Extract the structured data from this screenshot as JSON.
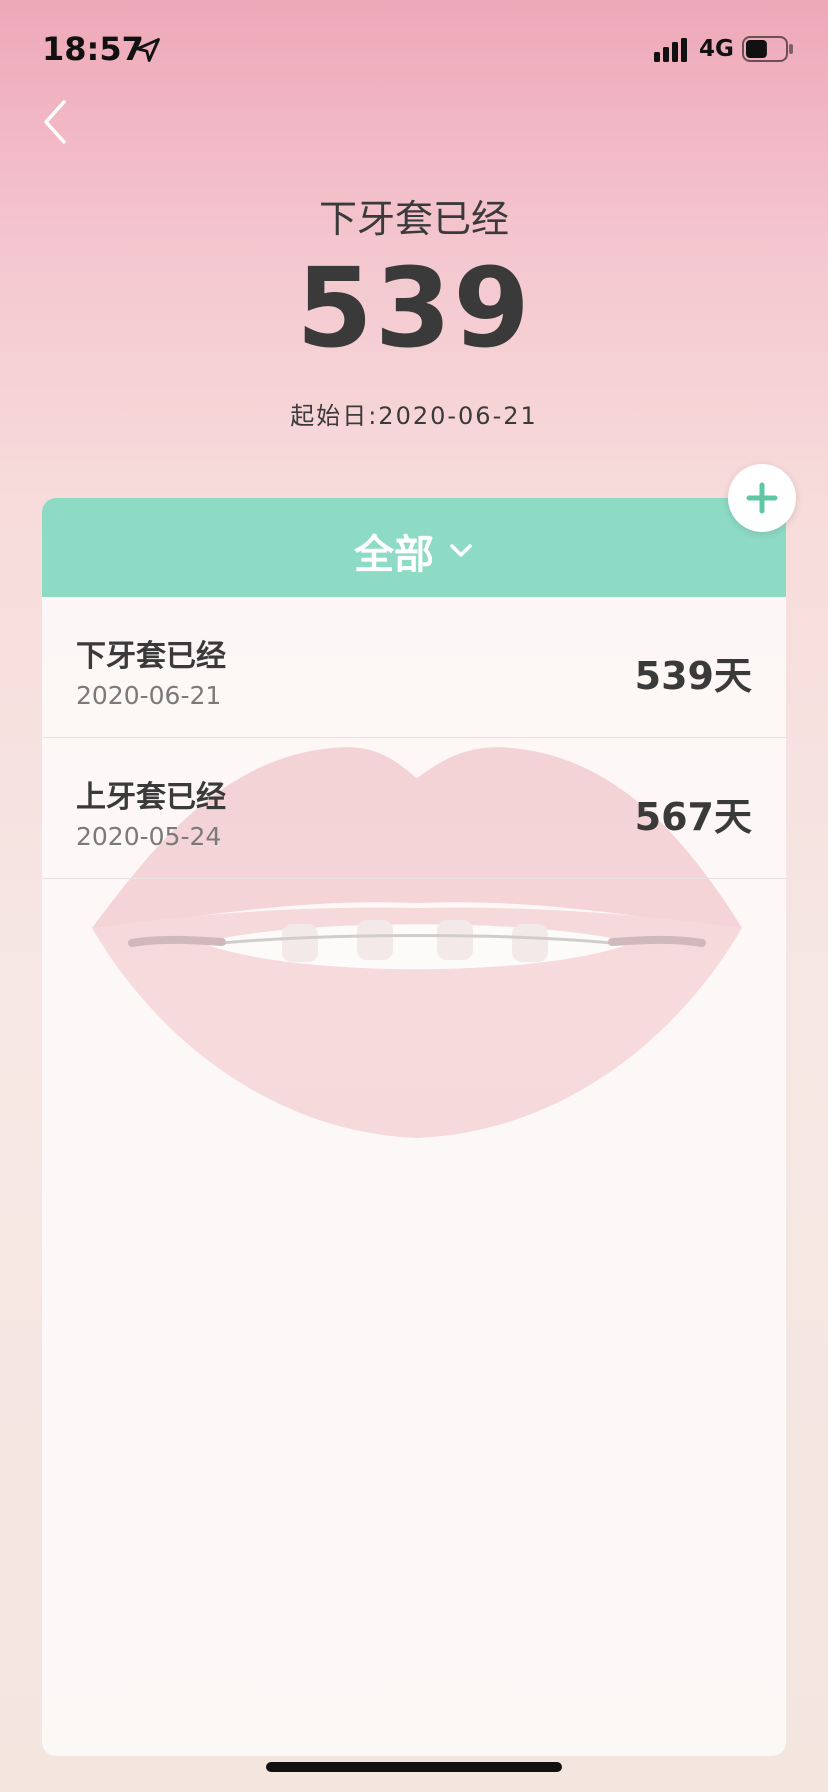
{
  "status_bar": {
    "time": "18:57",
    "network": "4G",
    "battery_level": 0.55,
    "icons": [
      "location-arrow-icon",
      "signal-icon",
      "battery-icon"
    ]
  },
  "nav": {
    "back_icon": "chevron-left-icon"
  },
  "header": {
    "title": "下牙套已经",
    "count": "539",
    "start_date": "起始日:2020-06-21"
  },
  "filter": {
    "label": "全部",
    "icon": "chevron-down-icon"
  },
  "add_button": {
    "icon": "plus-icon"
  },
  "items": [
    {
      "title": "下牙套已经",
      "date": "2020-06-21",
      "days": "539天"
    },
    {
      "title": "上牙套已经",
      "date": "2020-05-24",
      "days": "567天"
    }
  ],
  "colors": {
    "accent": "#8ddbc5",
    "plus": "#5fc7a3",
    "text": "#3a3a3a",
    "lips": "#eeb6bb"
  }
}
